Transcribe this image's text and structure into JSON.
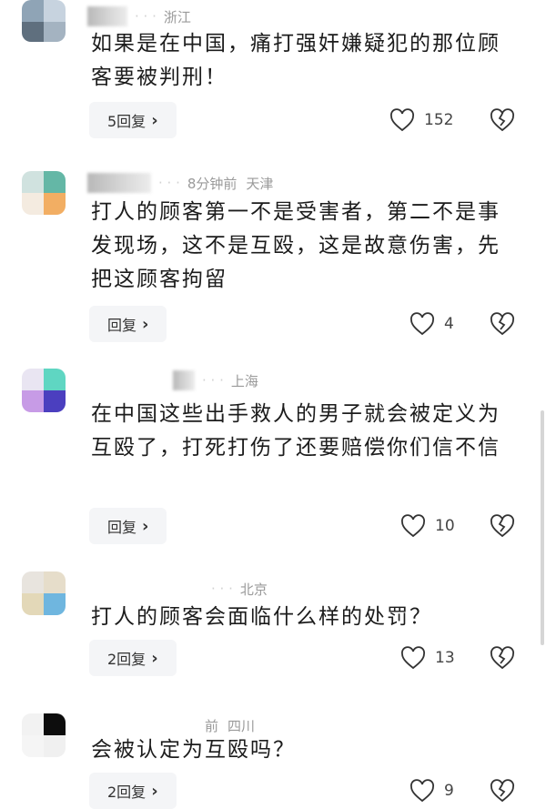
{
  "reply_chevron": "›",
  "comments": [
    {
      "location": "浙江",
      "time": "",
      "text": "如果是在中国，痛打强奸嫌疑犯的那位顾客要被判刑！",
      "reply_label": "5回复",
      "likes": "152",
      "avatar_colors": [
        "#8fa4b6",
        "#c7d3df",
        "#5f6f7e",
        "#a4b3c1"
      ]
    },
    {
      "location": "天津",
      "time": "8分钟前",
      "text": "打人的顾客第一不是受害者，第二不是事发现场，这不是互殴，这是故意伤害，先把这顾客拘留",
      "reply_label": "回复",
      "likes": "4",
      "avatar_colors": [
        "#d0e2df",
        "#64b7a6",
        "#f4ebe0",
        "#f2ae63"
      ]
    },
    {
      "location": "上海",
      "time": "",
      "text": "在中国这些出手救人的男子就会被定义为互殴了，打死打伤了还要赔偿你们信不信",
      "reply_label": "回复",
      "likes": "10",
      "avatar_colors": [
        "#e9e5f2",
        "#5fd6c2",
        "#c79be6",
        "#4b3fbf"
      ]
    },
    {
      "location": "北京",
      "time": "",
      "text": "打人的顾客会面临什么样的处罚？",
      "reply_label": "2回复",
      "likes": "13",
      "avatar_colors": [
        "#e8e4de",
        "#e6ddca",
        "#e3d8b8",
        "#6fb6df"
      ]
    },
    {
      "location": "四川",
      "time": "前",
      "text": "会被认定为互殴吗？",
      "reply_label": "2回复",
      "likes": "9",
      "avatar_colors": [
        "#f2f2f2",
        "#f5f5f5",
        "#f0f0f0",
        "#0d0d0d"
      ]
    }
  ]
}
